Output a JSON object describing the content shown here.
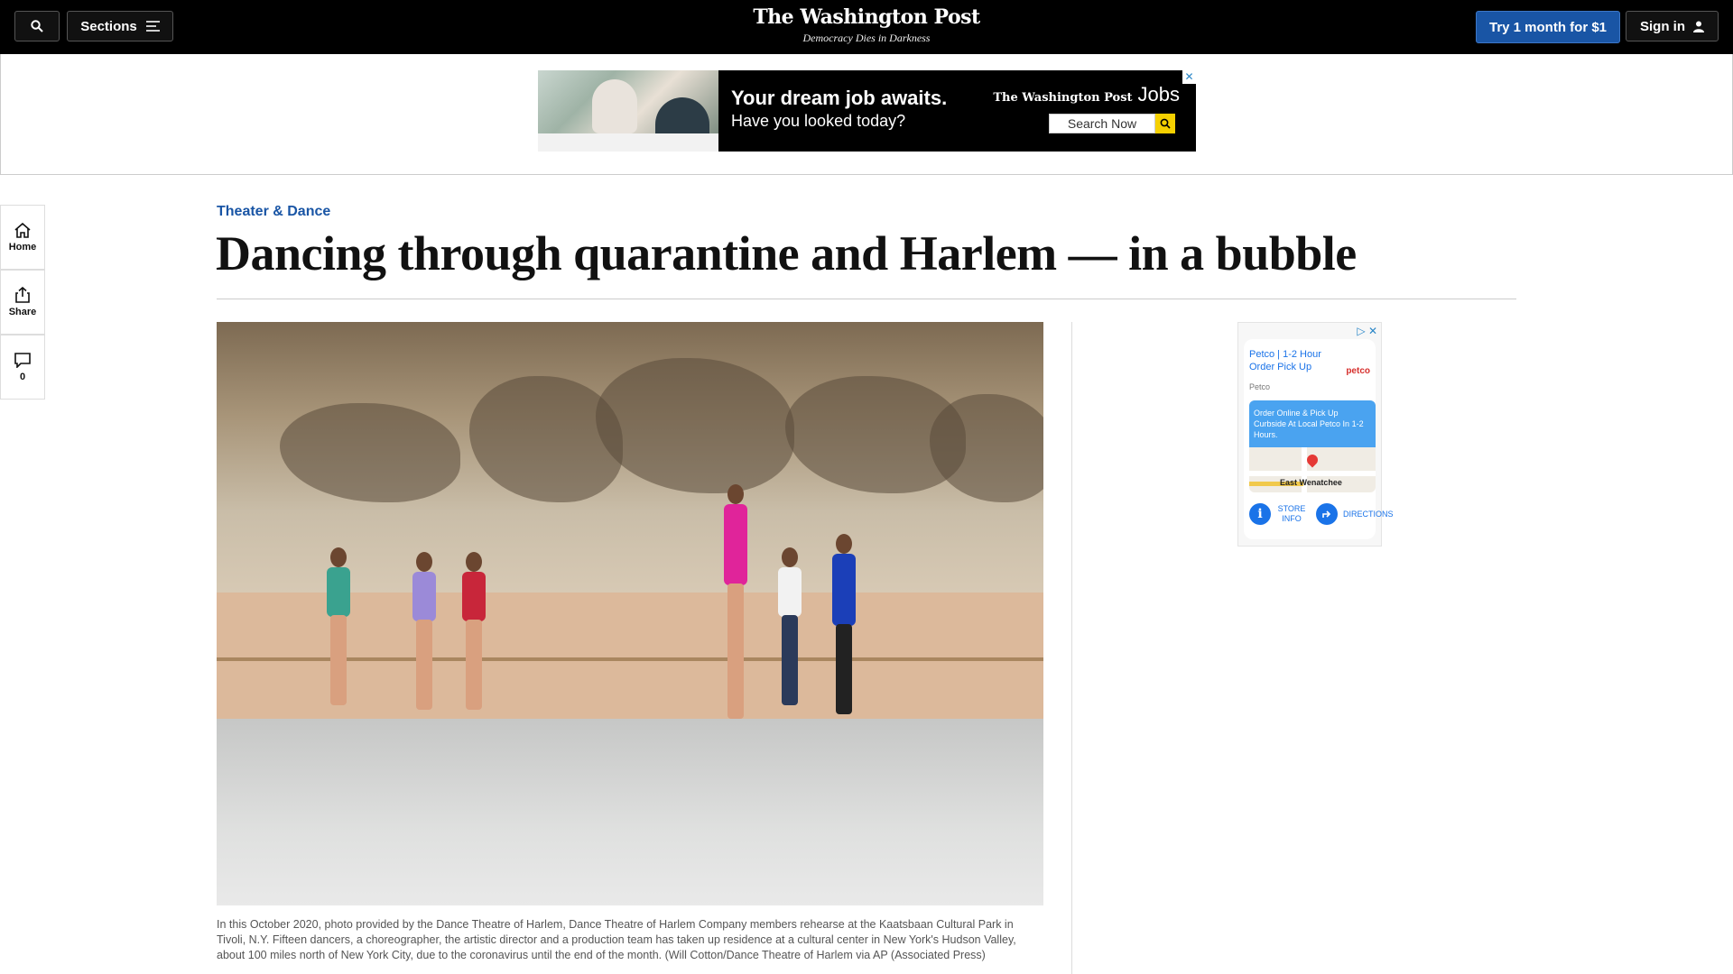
{
  "header": {
    "sections_label": "Sections",
    "logo": "The Washington Post",
    "tagline": "Democracy Dies in Darkness",
    "try_label": "Try 1 month for $1",
    "signin_label": "Sign in"
  },
  "top_ad": {
    "headline": "Your dream job awaits.",
    "subline": "Have you looked today?",
    "brand": "The Washington Post",
    "brand_suffix": "Jobs",
    "search_label": "Search Now",
    "close": "✕"
  },
  "rail": {
    "home_label": "Home",
    "share_label": "Share",
    "comments_count": "0"
  },
  "article": {
    "kicker": "Theater & Dance",
    "headline": "Dancing through quarantine and Harlem — in a bubble",
    "caption": "In this October 2020, photo provided by the Dance Theatre of Harlem, Dance Theatre of Harlem Company members rehearse at the Kaatsbaan Cultural Park in Tivoli, N.Y. Fifteen dancers, a choreographer, the artistic director and a production team has taken up residence at a cultural center in New York's Hudson Valley, about 100 miles north of New York City, due to the coronavirus until the end of the month. (Will Cotton/Dance Theatre of Harlem via AP (Associated Press)"
  },
  "side_ad": {
    "title": "Petco | 1-2 Hour Order Pick Up",
    "logo": "petco",
    "source": "Petco",
    "promo": "Order Online & Pick Up Curbside At Local Petco In 1-2 Hours.",
    "map_label": "East Wenatchee",
    "store_info": "STORE INFO",
    "directions": "DIRECTIONS"
  },
  "colors": {
    "brand_blue": "#1955a5",
    "nav_bg": "#000000",
    "link_blue": "#1a73e8"
  },
  "icons": [
    "search-icon",
    "menu-icon",
    "user-icon",
    "home-icon",
    "share-icon",
    "comment-icon",
    "ad-close-icon",
    "adchoices-icon",
    "info-icon",
    "directions-icon",
    "map-pin-icon"
  ]
}
